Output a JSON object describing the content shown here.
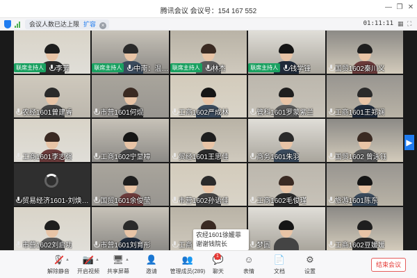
{
  "window": {
    "title": "腾讯会议 会议号：154 167 552",
    "minimize_glyph": "—",
    "restore_glyph": "❐",
    "close_glyph": "✕"
  },
  "infobar": {
    "notice": "会议人数已达上限",
    "expand": "扩容",
    "close_glyph": "×",
    "timer": "01:11:11"
  },
  "host_badge": "联席主持人",
  "nav": {
    "next_glyph": "▶"
  },
  "tiles": [
    {
      "name": "李芳",
      "host": true
    },
    {
      "name": "中南：温…",
      "host": true
    },
    {
      "name": "林杰",
      "host": true
    },
    {
      "name": "钱学锋",
      "host": true
    },
    {
      "name": "国贸1602秦川义",
      "host": false
    },
    {
      "name": "农经1601曾建睿",
      "host": false
    },
    {
      "name": "市营1601何焜",
      "host": false
    },
    {
      "name": "工商1602严成林",
      "host": false
    },
    {
      "name": "管科1601罗蒙紫兰",
      "host": false
    },
    {
      "name": "工商1601王郑娴",
      "host": false
    },
    {
      "name": "工商1601李志强",
      "host": false
    },
    {
      "name": "工商1602宁显樟",
      "host": false
    },
    {
      "name": "贸经1601王思佳",
      "host": false
    },
    {
      "name": "商务1601朱羽",
      "host": false
    },
    {
      "name": "国贸1602 曾泳钰",
      "host": false
    },
    {
      "name": "贸易经济1601-刘焕…",
      "host": false
    },
    {
      "name": "国贸1601余俊莹",
      "host": false
    },
    {
      "name": "市营1602孙语佳",
      "host": false
    },
    {
      "name": "工商1602毛俊瑾",
      "host": false
    },
    {
      "name": "旅游1601陈东",
      "host": false
    },
    {
      "name": "市营1602刘启功",
      "host": false
    },
    {
      "name": "市营1601刘育彤",
      "host": false
    },
    {
      "name": "工商",
      "host": false
    },
    {
      "name": "梦圆",
      "host": false
    },
    {
      "name": "工商1602豆媛媛",
      "host": false
    }
  ],
  "tooltip": {
    "line1": "农经1601徐媛菲",
    "line2": "谢谢钱院长"
  },
  "toolbar": {
    "items": [
      {
        "label": "解除静音",
        "icon": "mic-muted-icon"
      },
      {
        "label": "开启视频",
        "icon": "camera-off-icon"
      },
      {
        "label": "共享屏幕",
        "icon": "share-screen-icon"
      },
      {
        "label": "邀请",
        "icon": "invite-icon"
      },
      {
        "label": "管理成员(289)",
        "icon": "members-icon"
      },
      {
        "label": "聊天",
        "icon": "chat-icon",
        "badge": "1"
      },
      {
        "label": "表情",
        "icon": "emoji-icon"
      },
      {
        "label": "文档",
        "icon": "document-icon"
      },
      {
        "label": "设置",
        "icon": "settings-icon"
      }
    ],
    "end_button": "结束会议"
  },
  "colors": {
    "accent": "#1f7cf0",
    "host_green": "#1aa161",
    "end_red": "#e53935"
  }
}
